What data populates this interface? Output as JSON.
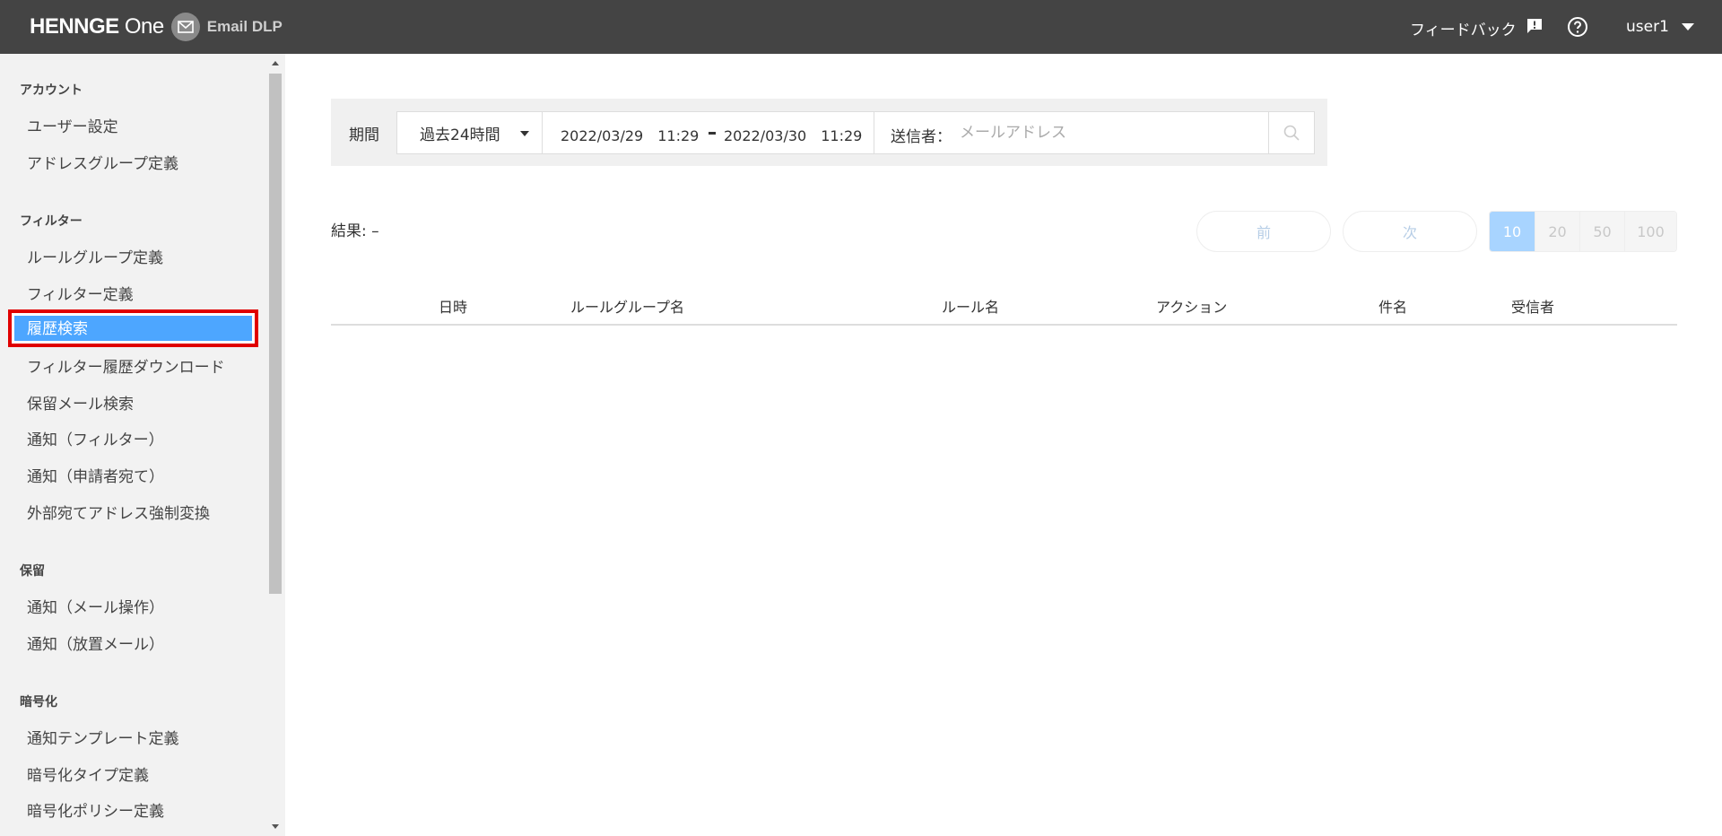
{
  "header": {
    "brand_main": "HENNGE",
    "brand_one": "One",
    "product": "Email DLP",
    "feedback": "フィードバック",
    "user": "user1"
  },
  "sidebar": {
    "sections": [
      {
        "title": "アカウント",
        "items": [
          "ユーザー設定",
          "アドレスグループ定義"
        ]
      },
      {
        "title": "フィルター",
        "items": [
          "ルールグループ定義",
          "フィルター定義",
          "履歴検索",
          "フィルター履歴ダウンロード",
          "保留メール検索",
          "通知（フィルター）",
          "通知（申請者宛て）",
          "外部宛てアドレス強制変換"
        ]
      },
      {
        "title": "保留",
        "items": [
          "通知（メール操作）",
          "通知（放置メール）"
        ]
      },
      {
        "title": "暗号化",
        "items": [
          "通知テンプレート定義",
          "暗号化タイプ定義",
          "暗号化ポリシー定義"
        ]
      }
    ],
    "active_item": "履歴検索"
  },
  "search": {
    "period_label": "期間",
    "period_value": "過去24時間",
    "date_from": "2022/03/29　11:29",
    "date_to": "2022/03/30　11:29",
    "sender_label": "送信者：",
    "sender_placeholder": "メールアドレス",
    "sender_value": ""
  },
  "results": {
    "label": "結果: –",
    "prev": "前",
    "next": "次",
    "page_sizes": [
      "10",
      "20",
      "50",
      "100"
    ],
    "selected_page_size": "10"
  },
  "table": {
    "columns": [
      "日時",
      "ルールグループ名",
      "ルール名",
      "アクション",
      "件名",
      "受信者"
    ]
  },
  "colors": {
    "header_bg": "#444444",
    "sidebar_bg": "#f2f2f2",
    "active_bg": "#4da6ff",
    "highlight_border": "#e00000"
  }
}
